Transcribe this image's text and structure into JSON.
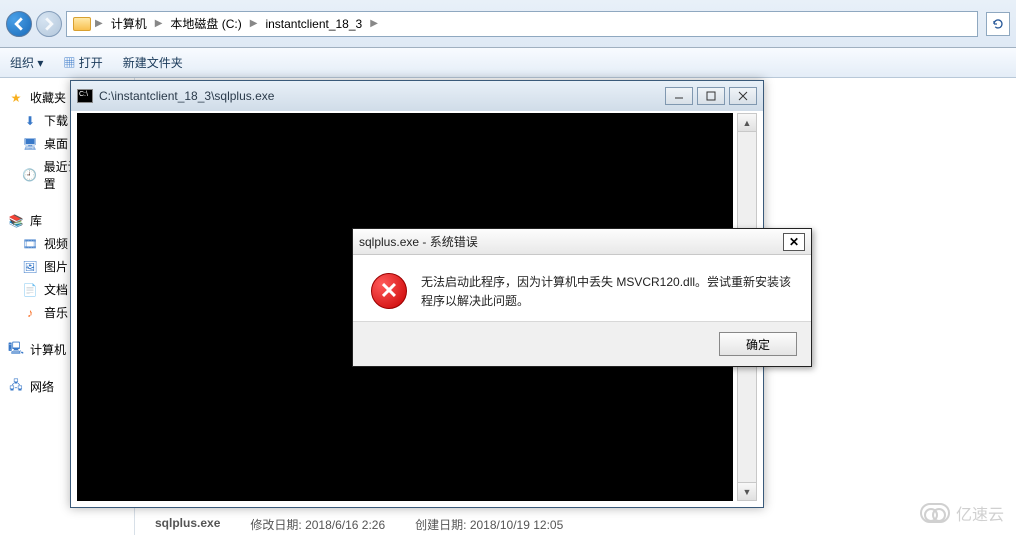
{
  "breadcrumb": {
    "items": [
      "计算机",
      "本地磁盘 (C:)",
      "instantclient_18_3"
    ]
  },
  "commandbar": {
    "organize": "组织",
    "open": "打开",
    "new_folder": "新建文件夹"
  },
  "sidebar": {
    "favorites": {
      "header": "收藏夹",
      "items": [
        "下载",
        "桌面",
        "最近访问的位置"
      ]
    },
    "libraries": {
      "header": "库",
      "items": [
        "视频",
        "图片",
        "文档",
        "音乐"
      ]
    },
    "computer": {
      "header": "计算机"
    },
    "network": {
      "header": "网络"
    }
  },
  "console": {
    "title": "C:\\instantclient_18_3\\sqlplus.exe"
  },
  "dialog": {
    "title": "sqlplus.exe - 系统错误",
    "message": "无法启动此程序，因为计算机中丢失 MSVCR120.dll。尝试重新安装该程序以解决此问题。",
    "ok": "确定"
  },
  "status": {
    "file": "sqlplus.exe",
    "mod_label": "修改日期:",
    "mod_value": "2018/6/16 2:26",
    "create_label": "创建日期:",
    "create_value": "2018/10/19 12:05"
  },
  "watermark": "亿速云"
}
